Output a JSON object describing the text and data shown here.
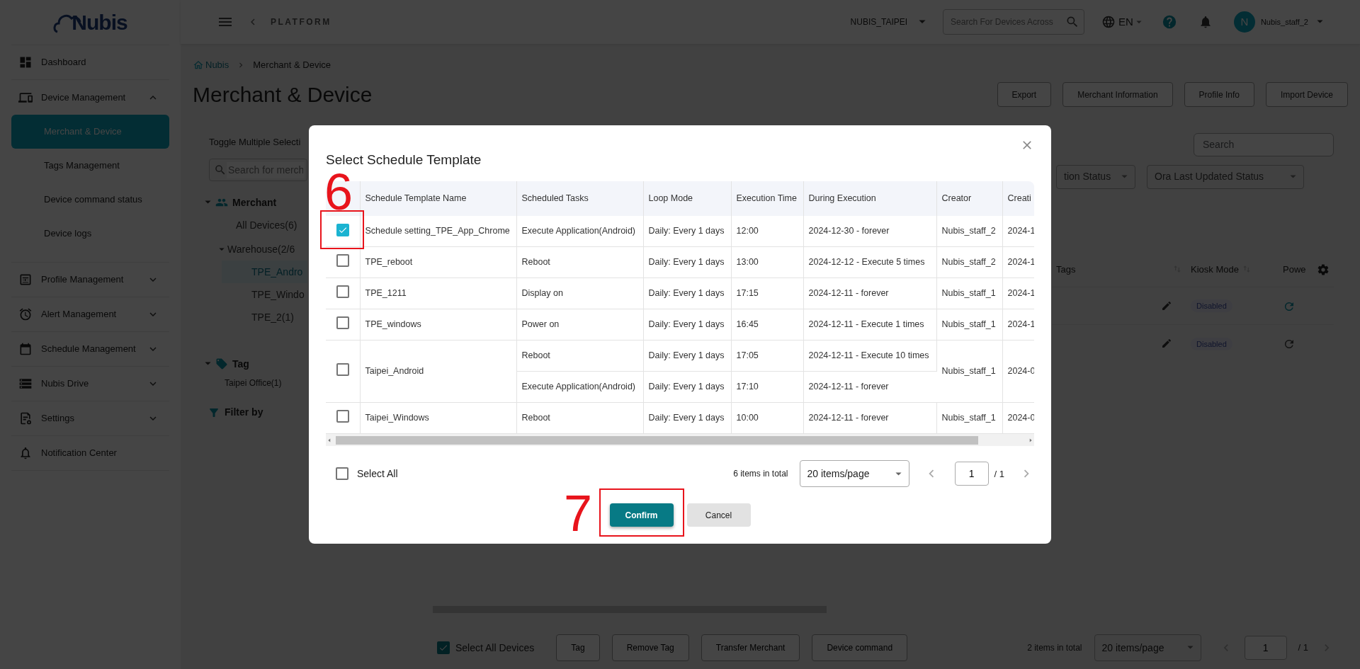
{
  "sidebar": {
    "logo": "Nubis",
    "items": [
      {
        "label": "Dashboard"
      },
      {
        "label": "Device Management",
        "expanded": true,
        "children": [
          {
            "label": "Merchant & Device",
            "selected": true
          },
          {
            "label": "Tags Management",
            "selected": false
          },
          {
            "label": "Device command status",
            "selected": false
          },
          {
            "label": "Device logs",
            "selected": false
          }
        ]
      },
      {
        "label": "Profile Management",
        "expanded": false
      },
      {
        "label": "Alert Management",
        "expanded": false
      },
      {
        "label": "Schedule Management",
        "expanded": false
      },
      {
        "label": "Nubis Drive",
        "expanded": false
      },
      {
        "label": "Settings",
        "expanded": false
      },
      {
        "label": "Notification Center"
      }
    ]
  },
  "header": {
    "back_label": "PLATFORM",
    "merchant": "NUBIS_TAIPEI",
    "search": {
      "placeholder": "Search For Devices Across"
    },
    "language": "EN",
    "avatar_initial": "N",
    "user": "Nubis_staff_2"
  },
  "breadcrumb": [
    "Nubis",
    "Merchant & Device"
  ],
  "page_title": "Merchant & Device",
  "actions": [
    "Export",
    "Merchant Information",
    "Profile Info",
    "Import Device"
  ],
  "left_panel": {
    "toggle_label": "Toggle Multiple Selecti",
    "search": {
      "placeholder": "Search for merch"
    },
    "merchant_heading": "Merchant",
    "merchant_expanded": true,
    "merchant_items": [
      {
        "label": "All Devices(6)",
        "selected": false
      },
      {
        "label": "Warehouse(2/6",
        "selected": false,
        "expanded": true,
        "children": [
          {
            "label": "TPE_Andro",
            "selected": true
          },
          {
            "label": "TPE_Windo",
            "selected": false
          },
          {
            "label": "TPE_2(1)",
            "selected": false
          }
        ]
      }
    ],
    "tag_heading": "Tag",
    "tag_expanded": true,
    "tags": [
      "Taipei Office(1)"
    ],
    "filter_label": "Filter by"
  },
  "device_area": {
    "search": {
      "placeholder": "Search"
    },
    "filters": [
      "tion Status",
      "Ora Last Updated Status"
    ],
    "columns": [
      "Tags",
      "Kiosk Mode",
      "Powe"
    ],
    "rows": [
      {
        "kiosk_mode": "Disabled",
        "highlighted": true
      },
      {
        "kiosk_mode": "Disabled",
        "highlighted": false
      }
    ]
  },
  "bulk_bar": {
    "select_all": {
      "label": "Select All Devices",
      "checked": true
    },
    "buttons": [
      "Tag",
      "Remove Tag",
      "Transfer Merchant",
      "Device command"
    ],
    "total": "2 items in total",
    "page_size": "20 items/page",
    "page": "1",
    "pages": "/ 1"
  },
  "modal": {
    "title": "Select Schedule Template",
    "columns": [
      "Schedule Template Name",
      "Scheduled Tasks",
      "Loop Mode",
      "Execution Time",
      "During Execution",
      "Creator",
      "Creati"
    ],
    "rows": [
      {
        "selected": true,
        "name": "Schedule setting_TPE_App_Chrome",
        "tasks": [
          {
            "task": "Execute Application(Android)",
            "loop": "Daily: Every 1 days",
            "time": "12:00",
            "during": "2024-12-30 - forever"
          }
        ],
        "creator": "Nubis_staff_2",
        "created": "2024-1"
      },
      {
        "selected": false,
        "name": "TPE_reboot",
        "tasks": [
          {
            "task": "Reboot",
            "loop": "Daily: Every 1 days",
            "time": "13:00",
            "during": "2024-12-12 - Execute 5 times"
          }
        ],
        "creator": "Nubis_staff_2",
        "created": "2024-1"
      },
      {
        "selected": false,
        "name": "TPE_1211",
        "tasks": [
          {
            "task": "Display on",
            "loop": "Daily: Every 1 days",
            "time": "17:15",
            "during": "2024-12-11 - forever"
          }
        ],
        "creator": "Nubis_staff_1",
        "created": "2024-1"
      },
      {
        "selected": false,
        "name": "TPE_windows",
        "tasks": [
          {
            "task": "Power on",
            "loop": "Daily: Every 1 days",
            "time": "16:45",
            "during": "2024-12-11 - Execute 1 times"
          }
        ],
        "creator": "Nubis_staff_1",
        "created": "2024-1"
      },
      {
        "selected": false,
        "name": "Taipei_Android",
        "tasks": [
          {
            "task": "Reboot",
            "loop": "Daily: Every 1 days",
            "time": "17:05",
            "during": "2024-12-11 - Execute 10 times"
          },
          {
            "task": "Execute Application(Android)",
            "loop": "Daily: Every 1 days",
            "time": "17:10",
            "during": "2024-12-11 - forever"
          }
        ],
        "creator": "Nubis_staff_1",
        "created": "2024-0"
      },
      {
        "selected": false,
        "name": "Taipei_Windows",
        "tasks": [
          {
            "task": "Reboot",
            "loop": "Daily: Every 1 days",
            "time": "10:00",
            "during": "2024-12-11 - forever"
          }
        ],
        "creator": "Nubis_staff_1",
        "created": "2024-0"
      }
    ],
    "select_all": {
      "label": "Select All",
      "checked": false
    },
    "total": "6 items in total",
    "page_size": "20 items/page",
    "page": "1",
    "pages": "/ 1",
    "buttons": [
      {
        "label": "Confirm",
        "kind": "primary"
      },
      {
        "label": "Cancel",
        "kind": "secondary"
      }
    ],
    "annotations": [
      {
        "label": "6"
      },
      {
        "label": "7"
      }
    ]
  }
}
